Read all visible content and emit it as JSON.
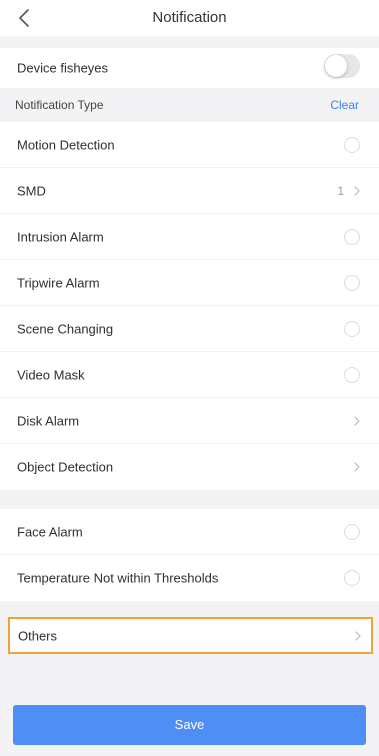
{
  "header": {
    "title": "Notification",
    "back_icon": "chevron-left-icon"
  },
  "device_fisheyes": {
    "label": "Device fisheyes",
    "enabled": false
  },
  "notification_type": {
    "title": "Notification Type",
    "clear_label": "Clear"
  },
  "groups": [
    {
      "items": [
        {
          "label": "Motion Detection",
          "control": "radio",
          "checked": false
        },
        {
          "label": "SMD",
          "control": "chevron",
          "count": "1"
        },
        {
          "label": "Intrusion Alarm",
          "control": "radio",
          "checked": false
        },
        {
          "label": "Tripwire Alarm",
          "control": "radio",
          "checked": false
        },
        {
          "label": "Scene Changing",
          "control": "radio",
          "checked": false
        },
        {
          "label": "Video Mask",
          "control": "radio",
          "checked": false
        },
        {
          "label": "Disk Alarm",
          "control": "chevron"
        },
        {
          "label": "Object Detection",
          "control": "chevron"
        }
      ]
    },
    {
      "items": [
        {
          "label": "Face Alarm",
          "control": "radio",
          "checked": false
        },
        {
          "label": "Temperature Not within Thresholds",
          "control": "radio",
          "checked": false
        }
      ]
    }
  ],
  "others": {
    "label": "Others",
    "highlighted": true
  },
  "save_label": "Save",
  "colors": {
    "accent": "#4f8ef5",
    "link": "#3b82f6",
    "highlight_border": "#f0a435",
    "background": "#f3f3f5"
  }
}
